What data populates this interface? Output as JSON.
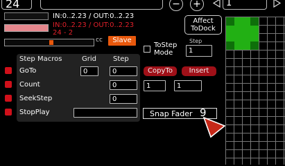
{
  "top": {
    "tempo_value": "24",
    "step_value": "1"
  },
  "levels": {
    "in_out_line1": "IN:0..2.23 / OUT:0..2.23",
    "in_out_line2": "IN:0..2.23 / OUT:0..2.23",
    "range_text": "24 - 2",
    "slave_label": "Slave",
    "cc_label": "cc",
    "slave_color": "#e8580c"
  },
  "affect_button": {
    "line1": "Affect",
    "line2": "ToDock"
  },
  "tostep": {
    "checkbox_label_line1": "ToStep",
    "checkbox_label_line2": "Mode",
    "step_label": "Step",
    "step_value": "1"
  },
  "macros": {
    "headers": {
      "title": "Step Macros",
      "grid": "Grid",
      "step": "Step"
    },
    "rows": [
      {
        "label": "GoTo",
        "grid_value": "0",
        "step_value": "0"
      },
      {
        "label": "Count",
        "step_value": "0"
      },
      {
        "label": "SeekStep",
        "step_value": "0"
      },
      {
        "label": "StopPlay",
        "text_value": ""
      }
    ]
  },
  "actions": {
    "copyto_label": "CopyTo",
    "insert_label": "Insert",
    "field1": "1",
    "field2": "1"
  },
  "snap": {
    "label": "Snap Fader",
    "value": "9"
  },
  "icons": {
    "minus": "minus-icon",
    "plus": "plus-icon",
    "left": "arrow-left-icon",
    "right": "arrow-right-icon"
  },
  "colors": {
    "accent_red": "#d0101a",
    "grid_green": "#22b014",
    "snap_arrow": "#c62818"
  }
}
